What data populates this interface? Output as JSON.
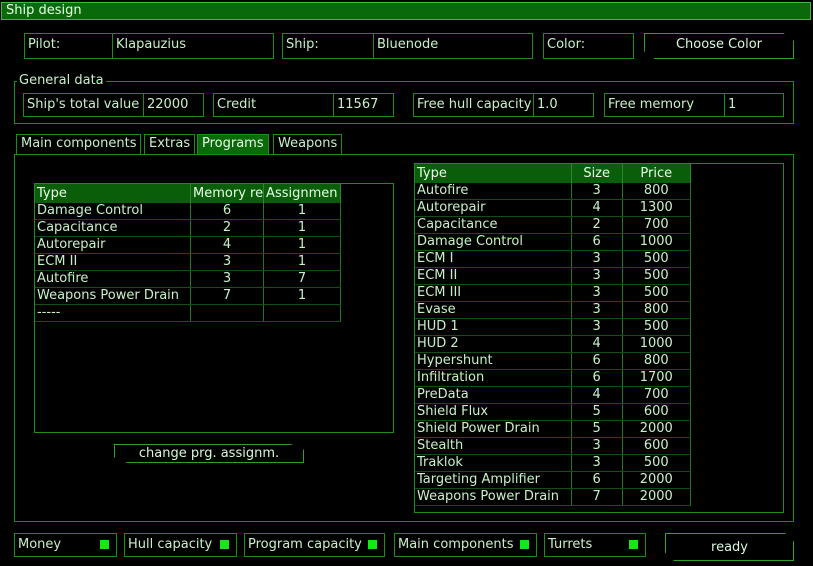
{
  "window": {
    "title": "Ship design"
  },
  "header": {
    "pilot_label": "Pilot:",
    "pilot_value": "Klapauzius",
    "ship_label": "Ship:",
    "ship_value": "Bluenode",
    "color_label": "Color:",
    "choose_color": "Choose Color"
  },
  "general": {
    "legend": "General data",
    "total_value_label": "Ship's total value",
    "total_value": "22000",
    "credit_label": "Credit",
    "credit": "11567",
    "free_hull_label": "Free hull capacity",
    "free_hull": "1.0",
    "free_memory_label": "Free memory",
    "free_memory": "1"
  },
  "tabs": [
    "Main components",
    "Extras",
    "Programs",
    "Weapons"
  ],
  "active_tab": "Programs",
  "installed": {
    "headers": [
      "Type",
      "Memory re",
      "Assignmen"
    ],
    "rows": [
      [
        "Damage Control",
        "6",
        "1"
      ],
      [
        "Capacitance",
        "2",
        "1"
      ],
      [
        "Autorepair",
        "4",
        "1"
      ],
      [
        "ECM II",
        "3",
        "1"
      ],
      [
        "Autofire",
        "3",
        "7"
      ],
      [
        "Weapons Power Drain",
        "7",
        "1"
      ],
      [
        "-----",
        "",
        ""
      ]
    ]
  },
  "change_button": "change prg. assignm.",
  "catalog": {
    "headers": [
      "Type",
      "Size",
      "Price"
    ],
    "rows": [
      [
        "Autofire",
        "3",
        "800"
      ],
      [
        "Autorepair",
        "4",
        "1300"
      ],
      [
        "Capacitance",
        "2",
        "700"
      ],
      [
        "Damage Control",
        "6",
        "1000"
      ],
      [
        "ECM I",
        "3",
        "500"
      ],
      [
        "ECM II",
        "3",
        "500"
      ],
      [
        "ECM III",
        "3",
        "500"
      ],
      [
        "Evase",
        "3",
        "800"
      ],
      [
        "HUD 1",
        "3",
        "500"
      ],
      [
        "HUD 2",
        "4",
        "1000"
      ],
      [
        "Hypershunt",
        "6",
        "800"
      ],
      [
        "Infiltration",
        "6",
        "1700"
      ],
      [
        "PreData",
        "4",
        "700"
      ],
      [
        "Shield Flux",
        "5",
        "600"
      ],
      [
        "Shield Power Drain",
        "5",
        "2000"
      ],
      [
        "Stealth",
        "3",
        "600"
      ],
      [
        "Traklok",
        "3",
        "500"
      ],
      [
        "Targeting Amplifier",
        "6",
        "2000"
      ],
      [
        "Weapons Power Drain",
        "7",
        "2000"
      ]
    ]
  },
  "status": {
    "money": "Money",
    "hull": "Hull capacity",
    "program": "Program capacity",
    "main": "Main components",
    "turrets": "Turrets",
    "indicator_color": "#19e619"
  },
  "ready_button": "ready"
}
